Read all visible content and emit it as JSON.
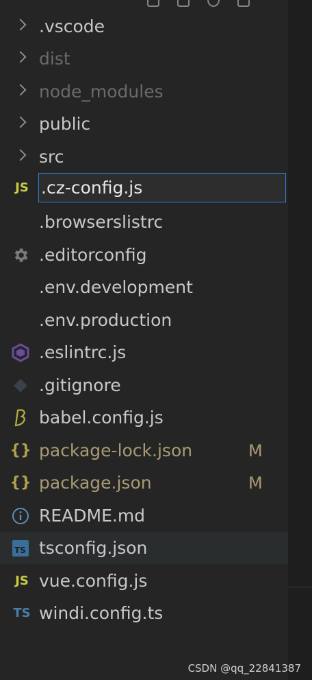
{
  "explorer": {
    "folders": [
      {
        "label": ".vscode",
        "dim": false
      },
      {
        "label": "dist",
        "dim": true
      },
      {
        "label": "node_modules",
        "dim": true
      },
      {
        "label": "public",
        "dim": false
      },
      {
        "label": "src",
        "dim": false
      }
    ],
    "rename_value": ".cz-config.js",
    "files": [
      {
        "label": ".browserslistrc",
        "icon": "lines-icon"
      },
      {
        "label": ".editorconfig",
        "icon": "gear-icon"
      },
      {
        "label": ".env.development",
        "icon": "lines-icon"
      },
      {
        "label": ".env.production",
        "icon": "lines-icon"
      },
      {
        "label": ".eslintrc.js",
        "icon": "eslint-icon"
      },
      {
        "label": ".gitignore",
        "icon": "git-icon"
      },
      {
        "label": "babel.config.js",
        "icon": "babel-icon"
      },
      {
        "label": "package-lock.json",
        "icon": "json-braces-icon",
        "badge": "M"
      },
      {
        "label": "package.json",
        "icon": "json-braces-icon",
        "badge": "M"
      },
      {
        "label": "README.md",
        "icon": "info-icon"
      },
      {
        "label": "tsconfig.json",
        "icon": "tsconfig-icon"
      },
      {
        "label": "vue.config.js",
        "icon": "js-icon"
      },
      {
        "label": "windi.config.ts",
        "icon": "ts-icon"
      }
    ],
    "icon_text": {
      "js": "JS",
      "json": "{}",
      "ts": "TS"
    }
  },
  "watermark": "CSDN @qq_22841387",
  "colors": {
    "sidebar_bg": "#252526",
    "editor_bg": "#1e1e1e",
    "focus_border": "#2f7fd6",
    "js_yellow": "#cbcb41",
    "json_yellow": "#b0a24e",
    "ts_blue": "#4d7fa5",
    "modified": "#a89a73"
  }
}
